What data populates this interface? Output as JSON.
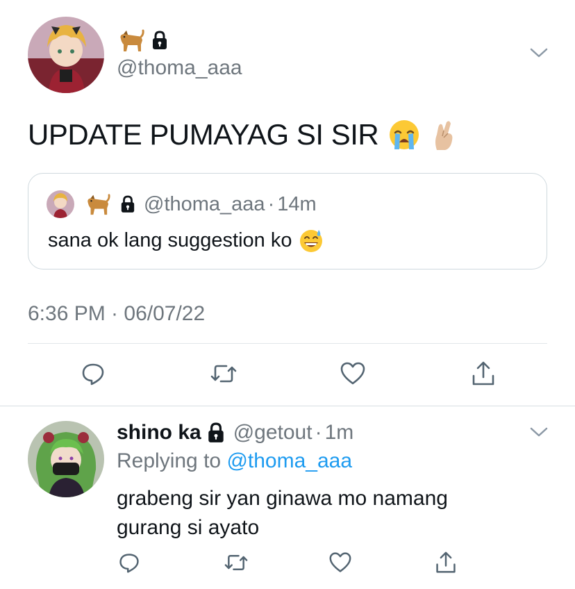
{
  "main_tweet": {
    "display_name_icons": [
      "dog-emoji",
      "lock-icon"
    ],
    "handle": "@thoma_aaa",
    "text": "UPDATE PUMAYAG SI SIR",
    "text_emojis": [
      "loudly-crying-face-emoji",
      "crossed-fingers-emoji"
    ],
    "quoted": {
      "handle": "@thoma_aaa",
      "separator": "·",
      "time": "14m",
      "text": "sana ok lang suggestion ko",
      "text_emoji": "grinning-sweat-emoji"
    },
    "timestamp": "6:36 PM · 06/07/22",
    "actions": [
      "reply-icon",
      "retweet-icon",
      "like-icon",
      "share-icon"
    ]
  },
  "reply": {
    "display_name": "shino ka",
    "handle": "@getout",
    "separator": "·",
    "time": "1m",
    "replying_prefix": "Replying to",
    "replying_handle": "@thoma_aaa",
    "text_line1": "grabeng sir yan ginawa mo namang",
    "text_line2": "gurang si ayato",
    "actions": [
      "reply-icon",
      "retweet-icon",
      "like-icon",
      "share-icon"
    ]
  },
  "colors": {
    "text": "#0f1419",
    "muted": "#6e767d",
    "link": "#1d9bf0",
    "divider": "#e1e6ea"
  }
}
